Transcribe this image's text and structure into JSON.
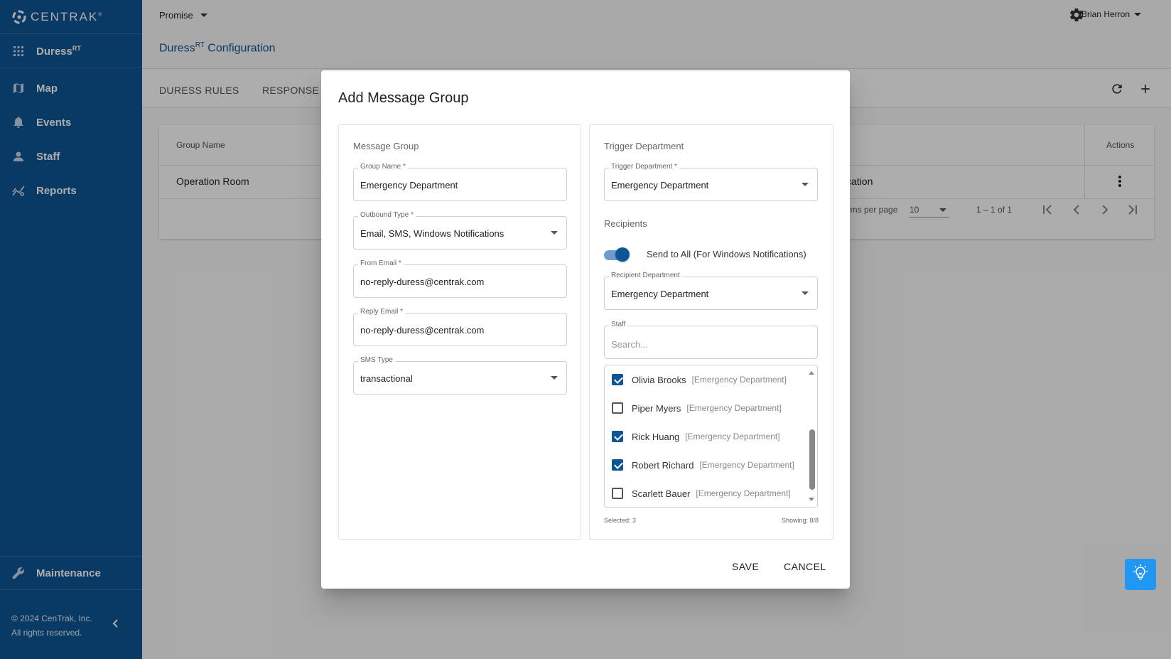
{
  "brand": {
    "name": "CENTRAK",
    "mark": "®"
  },
  "sidebar": {
    "app": {
      "label": "Duress",
      "sup": "RT"
    },
    "items": [
      {
        "label": "Map",
        "icon": "map-icon"
      },
      {
        "label": "Events",
        "icon": "bell-icon"
      },
      {
        "label": "Staff",
        "icon": "person-icon"
      },
      {
        "label": "Reports",
        "icon": "reports-icon"
      }
    ],
    "maintenance": "Maintenance",
    "footer_line1": "© 2024 CenTrak, Inc.",
    "footer_line2": "All rights reserved."
  },
  "header": {
    "org": "Promise",
    "user": "Brian Herron",
    "title_main": "Duress",
    "title_sup": "RT",
    "title_rest": " Configuration"
  },
  "tabs": [
    "DURESS RULES",
    "RESPONSE N"
  ],
  "table": {
    "columns": {
      "group_name": "Group Name",
      "actions": "Actions"
    },
    "rows": [
      {
        "group_name": "Operation Room",
        "partial": "fication"
      }
    ],
    "items_per_page_label": "items per page",
    "items_per_page": "10",
    "range": "1 – 1 of 1"
  },
  "dialog": {
    "title": "Add Message Group",
    "left_heading": "Message Group",
    "group_name": {
      "label": "Group Name *",
      "value": "Emergency Department"
    },
    "outbound_type": {
      "label": "Outbound Type *",
      "value": "Email, SMS, Windows Notifications"
    },
    "from_email": {
      "label": "From Email *",
      "value": "no-reply-duress@centrak.com"
    },
    "reply_email": {
      "label": "Reply Email *",
      "value": "no-reply-duress@centrak.com"
    },
    "sms_type": {
      "label": "SMS Type",
      "value": "transactional"
    },
    "right_heading": "Trigger Department",
    "trigger_department": {
      "label": "Trigger Department *",
      "value": "Emergency Department"
    },
    "recipients_heading": "Recipients",
    "send_to_all": {
      "label": "Send to All (For Windows Notifications)",
      "on": true
    },
    "recipient_department": {
      "label": "Recipient Department",
      "value": "Emergency Department"
    },
    "staff": {
      "label": "Staff",
      "placeholder": "Search..."
    },
    "staff_list": [
      {
        "name": "Olivia Brooks",
        "dept": "[Emergency Department]",
        "checked": true
      },
      {
        "name": "Piper Myers",
        "dept": "[Emergency Department]",
        "checked": false
      },
      {
        "name": "Rick Huang",
        "dept": "[Emergency Department]",
        "checked": true
      },
      {
        "name": "Robert Richard",
        "dept": "[Emergency Department]",
        "checked": true
      },
      {
        "name": "Scarlett Bauer",
        "dept": "[Emergency Department]",
        "checked": false
      }
    ],
    "selected": "Selected: 3",
    "showing": "Showing: 8/8",
    "save": "SAVE",
    "cancel": "CANCEL"
  },
  "colors": {
    "primary": "#0e5596",
    "help": "#2196f3"
  }
}
